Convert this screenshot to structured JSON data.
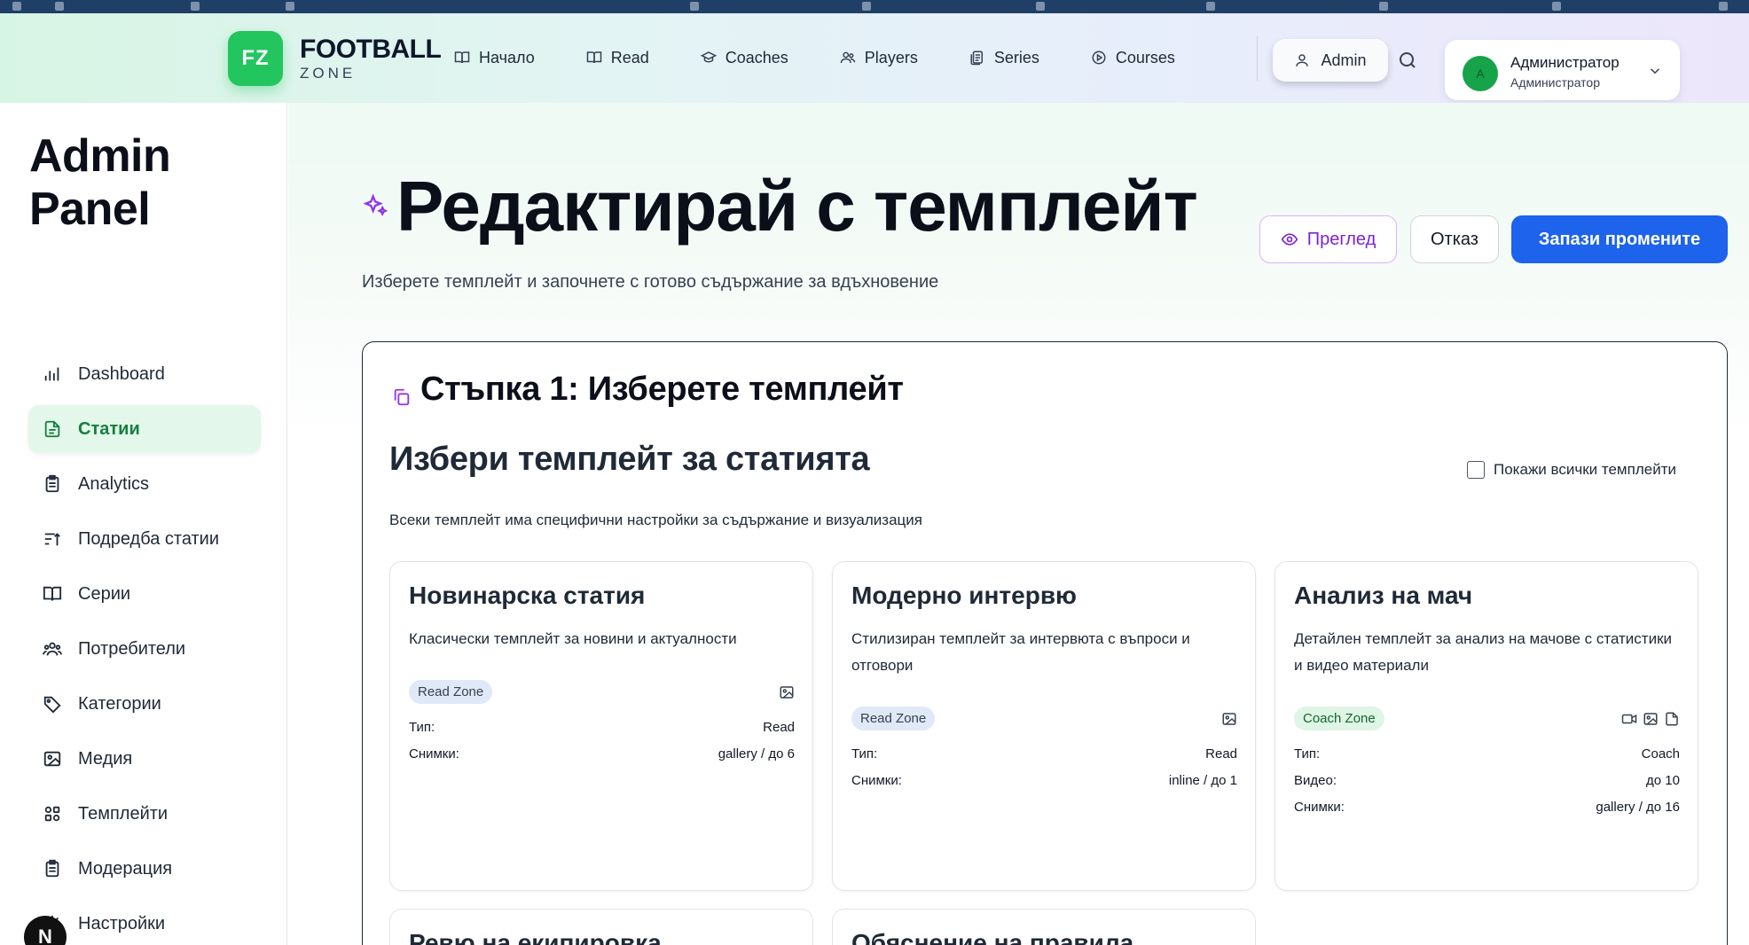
{
  "header": {
    "logo_initials": "FZ",
    "logo_title": "FOOTBALL",
    "logo_sub": "ZONE",
    "nav": [
      {
        "label": "Начало",
        "icon": "book-open-icon"
      },
      {
        "label": "Read",
        "icon": "book-open-icon"
      },
      {
        "label": "Coaches",
        "icon": "graduation-cap-icon"
      },
      {
        "label": "Players",
        "icon": "users-icon"
      },
      {
        "label": "Series",
        "icon": "series-icon"
      },
      {
        "label": "Courses",
        "icon": "play-circle-icon"
      }
    ],
    "admin_label": "Admin",
    "user": {
      "avatar_letter": "A",
      "name": "Администратор",
      "role": "Администратор"
    }
  },
  "sidebar": {
    "title": "Admin Panel",
    "items": [
      {
        "label": "Dashboard",
        "icon": "bar-chart-icon"
      },
      {
        "label": "Статии",
        "icon": "file-text-icon",
        "active": true
      },
      {
        "label": "Analytics",
        "icon": "clipboard-icon"
      },
      {
        "label": "Подредба статии",
        "icon": "sort-icon"
      },
      {
        "label": "Серии",
        "icon": "book-open-icon"
      },
      {
        "label": "Потребители",
        "icon": "users-icon"
      },
      {
        "label": "Категории",
        "icon": "tag-icon"
      },
      {
        "label": "Медия",
        "icon": "image-icon"
      },
      {
        "label": "Темплейти",
        "icon": "grid-icon"
      },
      {
        "label": "Модерация",
        "icon": "clipboard-icon"
      },
      {
        "label": "Настройки",
        "icon": "gear-icon"
      }
    ],
    "bottom_badge": "N"
  },
  "main": {
    "title": "Редактирай с темплейт",
    "subtitle": "Изберете темплейт и започнете с готово съдържание за вдъхновение",
    "buttons": {
      "preview": "Преглед",
      "cancel": "Отказ",
      "save": "Запази промените"
    },
    "step": {
      "title": "Стъпка 1: Изберете темплейт",
      "section_title": "Избери темплейт за статията",
      "show_all_label": "Покажи всички темплейти",
      "section_sub": "Всеки темплейт има специфични настройки за съдържание и визуализация"
    },
    "templates": [
      {
        "title": "Новинарска статия",
        "desc": "Класически темплейт за новини и актуалности",
        "badge": "Read Zone",
        "rows": [
          {
            "label": "Тип:",
            "value": "Read"
          },
          {
            "label": "Снимки:",
            "value": "gallery / до 6"
          }
        ]
      },
      {
        "title": "Модерно интервю",
        "desc": "Стилизиран темплейт за интервюта с въпроси и отговори",
        "badge": "Read Zone",
        "rows": [
          {
            "label": "Тип:",
            "value": "Read"
          },
          {
            "label": "Снимки:",
            "value": "inline / до 1"
          }
        ]
      },
      {
        "title": "Анализ на мач",
        "desc": "Детайлен темплейт за анализ на мачове с статистики и видео материали",
        "badge": "Coach Zone",
        "rows": [
          {
            "label": "Тип:",
            "value": "Coach"
          },
          {
            "label": "Видео:",
            "value": "до 10"
          },
          {
            "label": "Снимки:",
            "value": "gallery / до 16"
          }
        ]
      }
    ],
    "templates_partial": [
      {
        "title": "Ревю на екипировка"
      },
      {
        "title": "Обяснение на правила"
      }
    ]
  },
  "colors": {
    "brand_green": "#22c55e",
    "primary_blue": "#1d63ec",
    "preview_purple": "#7e22ce",
    "active_bg": "#e3f7ea"
  }
}
